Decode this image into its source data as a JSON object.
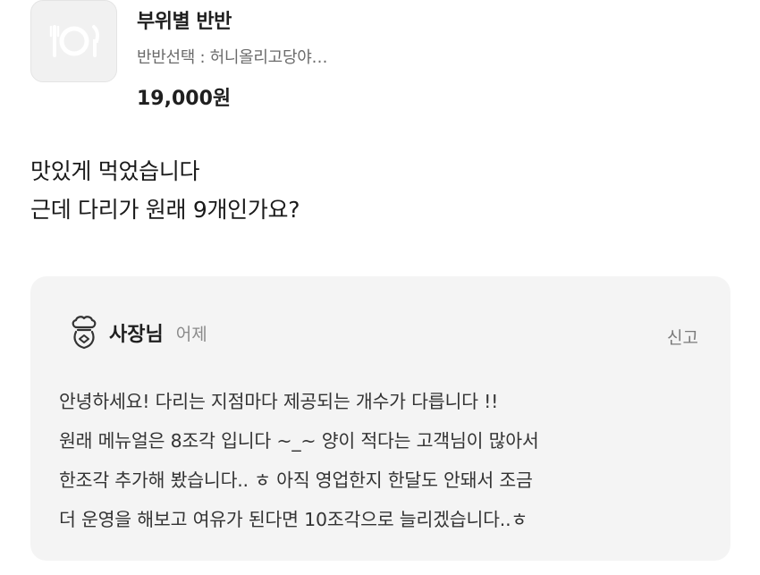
{
  "product": {
    "name": "부위별 반반",
    "option": "반반선택 : 허니올리고당야…",
    "price": "19,000원",
    "thumbnail_icon": "plate-utensils-icon"
  },
  "review": {
    "lines": [
      "맛있게 먹었습니다",
      "근데 다리가 원래 9개인가요?"
    ]
  },
  "reply": {
    "author": "사장님",
    "date": "어제",
    "report_label": "신고",
    "icon": "chef-hat-icon",
    "lines": [
      "안녕하세요! 다리는 지점마다 제공되는 개수가 다릅니다 !!",
      "원래 메뉴얼은 8조각 입니다 ~_~ 양이 적다는 고객님이 많아서",
      "한조각 추가해 봤습니다.. ㅎ  아직 영업한지 한달도 안돼서 조금",
      "더 운영을 해보고 여유가 된다면 10조각으로 늘리겠습니다..ㅎ"
    ]
  },
  "colors": {
    "thumb_bg": "#f1f1f1",
    "reply_bg": "#f4f4f4",
    "muted_text": "#8a8a8a"
  }
}
